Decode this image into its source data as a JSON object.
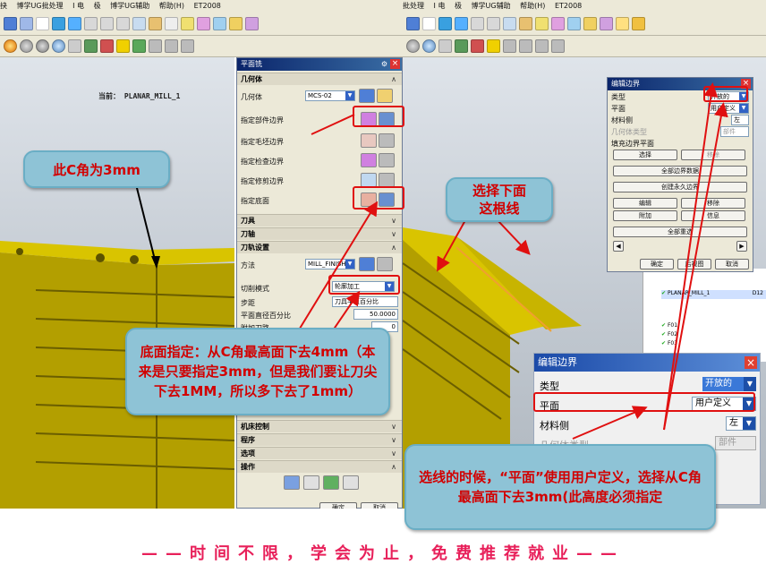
{
  "left_window": {
    "menu": [
      "抉",
      "博学UG批处理",
      "I 电",
      "极",
      "博学UG辅助",
      "帮助(H)",
      "ET2008"
    ],
    "viewport_title": "当前： PLANAR_MILL_1"
  },
  "right_window": {
    "menu": [
      "批处理",
      "I 电",
      "极",
      "博学UG辅助",
      "帮助(H)",
      "ET2008"
    ]
  },
  "planar_mill_dialog": {
    "title": "平面铣",
    "sections": {
      "geometry": "几何体",
      "tool": "刀具",
      "axis": "刀轴",
      "path_settings": "刀轨设置",
      "machine_control": "机床控制",
      "program": "程序",
      "options": "选项",
      "actions": "操作"
    },
    "geometry_label": "几何体",
    "geometry_value": "MCS-02",
    "specify_part_boundary": "指定部件边界",
    "specify_blank_boundary": "指定毛坯边界",
    "specify_check_boundary": "指定检查边界",
    "specify_trim_boundary": "指定修剪边界",
    "specify_floor": "指定底面",
    "method_label": "方法",
    "method_value": "MILL_FINISH",
    "cut_mode_label": "切削模式",
    "cut_mode_value": "轮廓加工",
    "stepover_label": "步距",
    "stepover_value": "刀具平直百分比",
    "flat_diameter_label": "平面直径百分比",
    "flat_diameter_value": "50.0000",
    "extra_passes_label": "附加刀路",
    "extra_passes_value": "0",
    "ok_label": "确定",
    "cancel_label": "取消"
  },
  "edit_boundary_small": {
    "title": "编辑边界",
    "type_label": "类型",
    "type_value": "开放的",
    "plane_label": "平面",
    "plane_value": "用户定义",
    "material_side_label": "材料侧",
    "material_side_value": "左",
    "geometry_type_label": "几何体类型",
    "geometry_type_value": "部件",
    "fill_plane_label": "填充边界平面",
    "select_label": "选择",
    "remove_label": "移除",
    "boundary_data_label": "全部边界数据",
    "create_permanent_label": "创建永久边界",
    "edit_label": "编辑",
    "remove2_label": "移除",
    "append_label": "附加",
    "info_label": "信息",
    "reselect_all_label": "全部重选",
    "ok_label": "确定",
    "back_label": "后视图",
    "cancel_label": "取消"
  },
  "nav_tree": {
    "items": [
      "PLANAR_MILL_1",
      "D12",
      "F01",
      "F02",
      "F03"
    ]
  },
  "edit_boundary_large": {
    "title": "编辑边界",
    "type_label": "类型",
    "type_value": "开放的",
    "plane_label": "平面",
    "plane_value": "用户定义",
    "material_side_label": "材料侧",
    "material_side_value": "左",
    "geometry_type_label": "几何体类型",
    "geometry_type_value": "部件"
  },
  "callouts": {
    "c_corner": "此C角为3mm",
    "select_bottom_line": "选择下面\n这根线",
    "floor_note": "底面指定：从C角最高面下去4mm（本来是只要指定3mm，但是我们要让刀尖下去1MM，所以多下去了1mm）",
    "plane_note": "选线的时候，“平面”使用用户定义，选择从C角最高面下去3mm(此高度必须指定"
  },
  "footer": "——时间不限，学会为止，免费推荐就业——",
  "colors": {
    "part_yellow": "#c8b400",
    "callout_blue": "#8ec3d6",
    "callout_text": "#d20000",
    "arrow_red": "#e01010",
    "footer_pink": "#e8205a"
  }
}
